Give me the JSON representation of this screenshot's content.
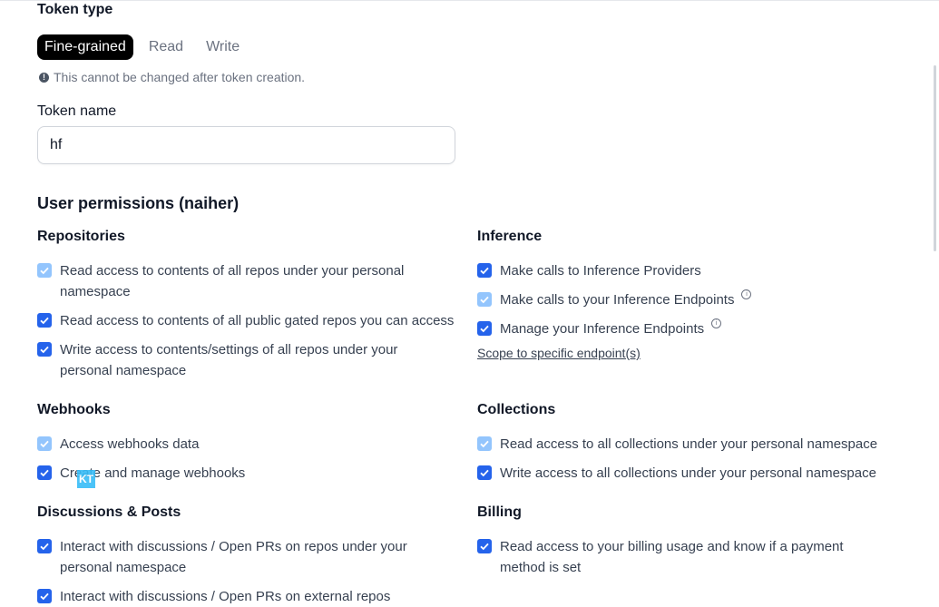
{
  "token_type": {
    "heading": "Token type",
    "options": [
      "Fine-grained",
      "Read",
      "Write"
    ],
    "selected": "Fine-grained",
    "note": "This cannot be changed after token creation."
  },
  "token_name": {
    "label": "Token name",
    "value": "hf"
  },
  "user_permissions": {
    "heading": "User permissions (naiher)"
  },
  "sections": {
    "repositories": {
      "title": "Repositories",
      "items": [
        {
          "label": "Read access to contents of all repos under your personal namespace",
          "checked": true,
          "disabled": true
        },
        {
          "label": "Read access to contents of all public gated repos you can access",
          "checked": true,
          "disabled": false
        },
        {
          "label": "Write access to contents/settings of all repos under your personal namespace",
          "checked": true,
          "disabled": false
        }
      ]
    },
    "inference": {
      "title": "Inference",
      "items": [
        {
          "label": "Make calls to Inference Providers",
          "checked": true,
          "disabled": false
        },
        {
          "label": "Make calls to your Inference Endpoints",
          "checked": true,
          "disabled": true
        },
        {
          "label": "Manage your Inference Endpoints",
          "checked": true,
          "disabled": false
        }
      ],
      "link": "Scope to specific endpoint(s)"
    },
    "webhooks": {
      "title": "Webhooks",
      "items": [
        {
          "label": "Access webhooks data",
          "checked": true,
          "disabled": true
        },
        {
          "label": "Create and manage webhooks",
          "checked": true,
          "disabled": false
        }
      ]
    },
    "collections": {
      "title": "Collections",
      "items": [
        {
          "label": "Read access to all collections under your personal namespace",
          "checked": true,
          "disabled": true
        },
        {
          "label": "Write access to all collections under your personal namespace",
          "checked": true,
          "disabled": false
        }
      ]
    },
    "discussions": {
      "title": "Discussions & Posts",
      "items": [
        {
          "label": "Interact with discussions / Open PRs on repos under your personal namespace",
          "checked": true,
          "disabled": false
        },
        {
          "label": "Interact with discussions / Open PRs on external repos",
          "checked": true,
          "disabled": false
        }
      ]
    },
    "billing": {
      "title": "Billing",
      "items": [
        {
          "label": "Read access to your billing usage and know if a payment method is set",
          "checked": true,
          "disabled": false
        }
      ]
    }
  },
  "overlay_badge": "KT",
  "colors": {
    "accent": "#2563eb",
    "accent_light": "#93c5fd",
    "selected_bg": "#000000"
  }
}
